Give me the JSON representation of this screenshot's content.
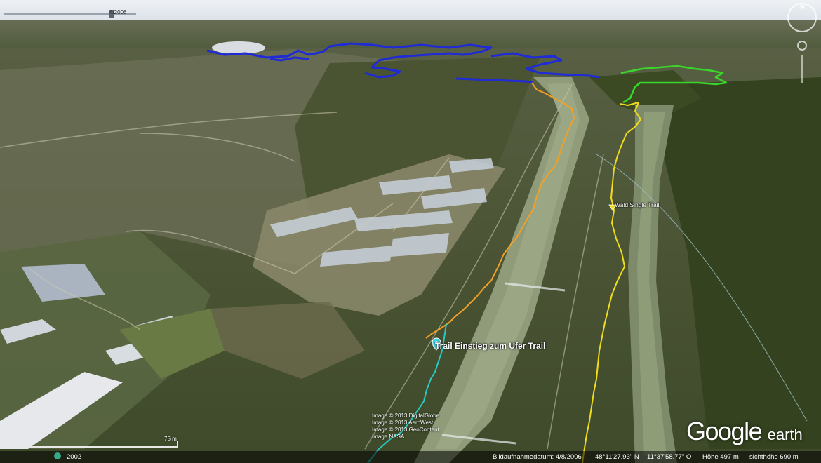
{
  "history": {
    "date": "4/2006"
  },
  "placemarks": {
    "ufer": {
      "label": "Trail Einstieg zum Ufer Trail"
    },
    "wald": {
      "label": "Wald Single Trail"
    }
  },
  "tracks": [
    {
      "name": "blue",
      "color": "#1f2bd6"
    },
    {
      "name": "green",
      "color": "#3bd62a"
    },
    {
      "name": "orange",
      "color": "#f2a125"
    },
    {
      "name": "yellow",
      "color": "#f0dc1c"
    },
    {
      "name": "cyan",
      "color": "#29c9c3"
    }
  ],
  "compass": {
    "north": "N"
  },
  "scale": {
    "label": "75 m"
  },
  "copyright": {
    "line1": "Image © 2013 DigitalGlobe",
    "line2": "Image © 2013 AeroWest",
    "line3": "Image © 2013 GeoContent",
    "line4": "Image NASA"
  },
  "brand": {
    "word1": "Google",
    "word2": "earth"
  },
  "status": {
    "year": "2002",
    "date": "Bildaufnahmedatum: 4/8/2006",
    "lat": "48°11'27.93\" N",
    "lon": "11°37'58.77\" O",
    "elev": "Höhe   497 m",
    "eye": "sichthöhe   690 m"
  }
}
